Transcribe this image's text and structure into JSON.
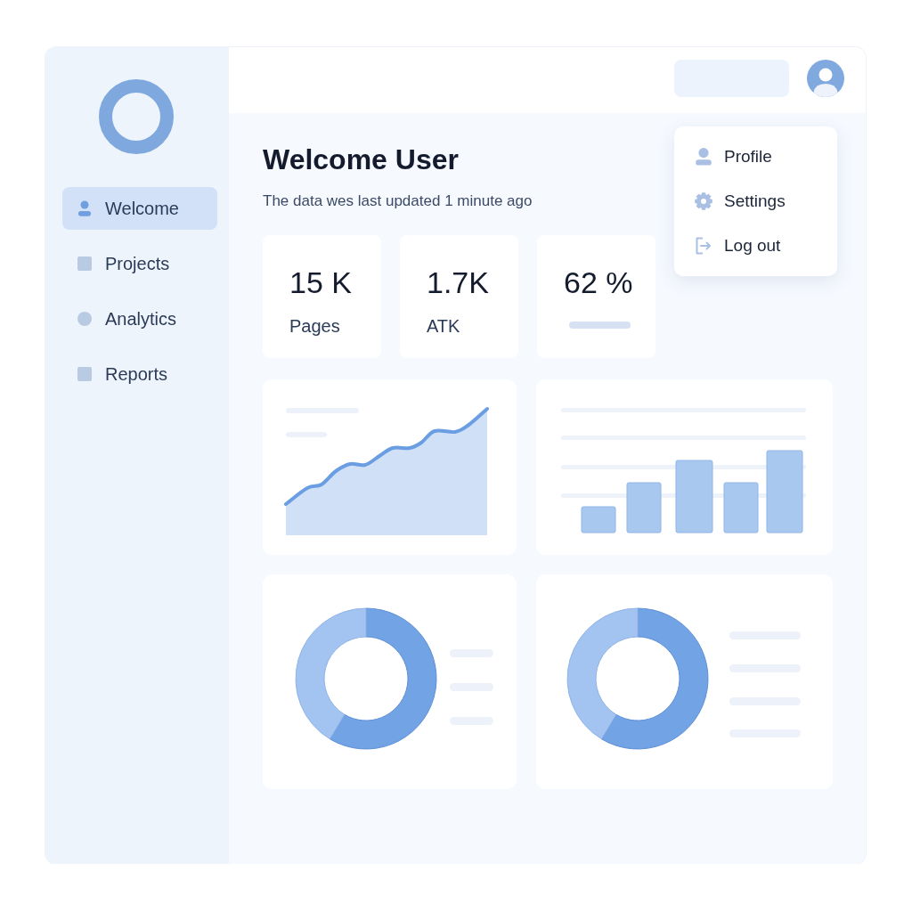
{
  "sidebar": {
    "items": [
      {
        "label": "Welcome",
        "selected": true
      },
      {
        "label": "Projects",
        "selected": false
      },
      {
        "label": "Analytics",
        "selected": false
      },
      {
        "label": "Reports",
        "selected": false
      }
    ]
  },
  "user_menu": {
    "items": [
      {
        "label": "Profile"
      },
      {
        "label": "Settings"
      },
      {
        "label": "Log out"
      }
    ]
  },
  "welcome": {
    "title": "Welcome User",
    "subtitle": "The data wes last updated 1 minute ago"
  },
  "stats": [
    {
      "kind": "labeled",
      "value": "15 K",
      "label": "Pages"
    },
    {
      "kind": "labeled",
      "value": "1.7K",
      "label": "ATK"
    },
    {
      "kind": "skeleton",
      "value": "62 %"
    }
  ],
  "panels": [
    {
      "kind": "area"
    },
    {
      "kind": "bar"
    },
    {
      "kind": "donut"
    },
    {
      "kind": "donut"
    }
  ]
}
